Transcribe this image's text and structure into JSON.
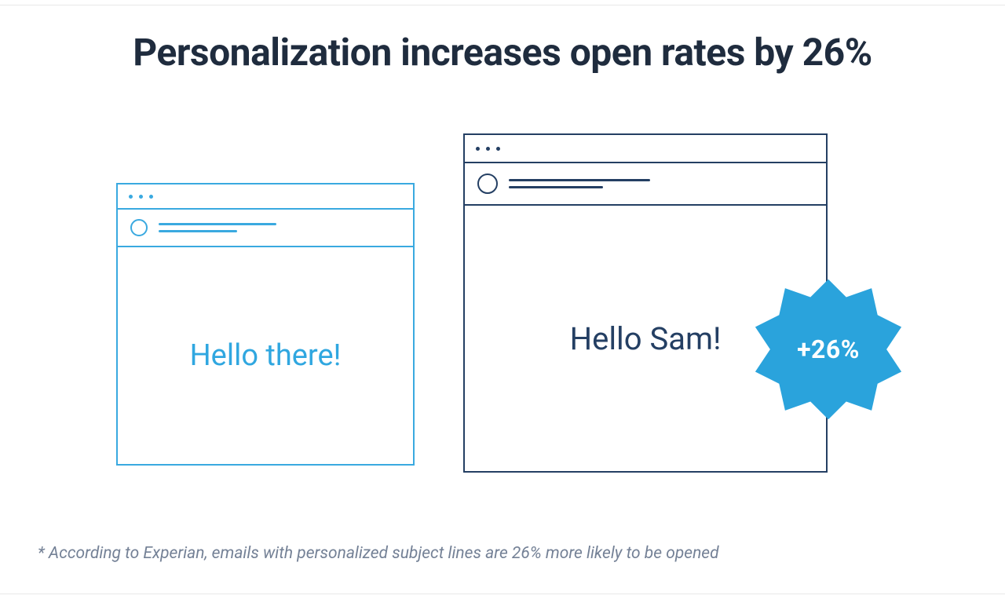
{
  "title": "Personalization increases open rates by 26%",
  "generic_panel": {
    "greeting": "Hello there!"
  },
  "personalized_panel": {
    "greeting": "Hello Sam!"
  },
  "badge": {
    "label": "+26%"
  },
  "footnote": "* According to Experian, emails with personalized subject lines are 26% more likely to be opened",
  "colors": {
    "navy": "#243f63",
    "sky": "#3aa9e0",
    "badge": "#2aa3dc"
  }
}
